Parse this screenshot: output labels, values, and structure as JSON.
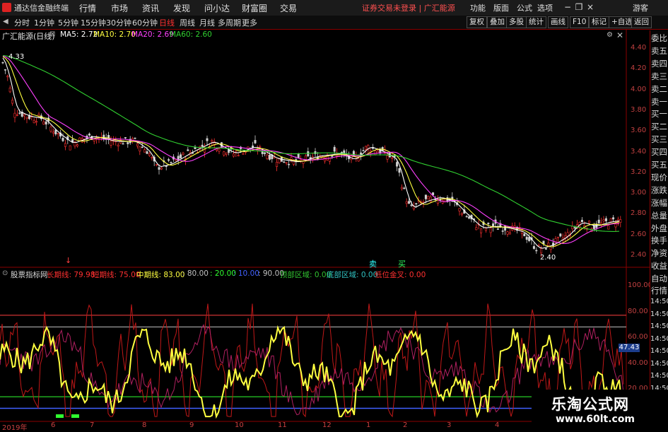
{
  "app": {
    "name": "通达信金融终端"
  },
  "menus": [
    "行情",
    "市场",
    "资讯",
    "发现",
    "问小达",
    "财富圈",
    "交易"
  ],
  "alert": "证券交易未登录",
  "alert_stock": "广汇能源",
  "right_menus": [
    "功能",
    "版面",
    "公式",
    "选项"
  ],
  "right_account": "游客",
  "period_tabs": [
    {
      "label": "分时"
    },
    {
      "label": "1分钟"
    },
    {
      "label": "5分钟"
    },
    {
      "label": "15分钟"
    },
    {
      "label": "30分钟"
    },
    {
      "label": "60分钟"
    },
    {
      "label": "日线",
      "active": true
    },
    {
      "label": "周线"
    },
    {
      "label": "月线"
    },
    {
      "label": "多周期"
    },
    {
      "label": "更多"
    }
  ],
  "right_tools": [
    "复权",
    "叠加",
    "多股",
    "统计",
    "画线",
    "F10",
    "标记",
    "+自选",
    "返回"
  ],
  "stock": {
    "name": "广汇能源(日线)",
    "ma5": "MA5: 2.72",
    "ma10": "MA10: 2.70",
    "ma20": "MA20: 2.69",
    "ma60": "MA60: 2.60",
    "high_label": "4.33",
    "low_label": "2.40"
  },
  "price_axis": [
    "4.40",
    "4.20",
    "4.00",
    "3.80",
    "3.60",
    "3.40",
    "3.20",
    "3.00",
    "2.80",
    "2.60",
    "2.40"
  ],
  "markers": {
    "down": "↓",
    "sell": "卖",
    "buy": "买"
  },
  "right_column": [
    "委比",
    "卖五",
    "卖四",
    "卖三",
    "卖二",
    "卖一",
    "买一",
    "买二",
    "买三",
    "买四",
    "买五",
    "现价",
    "涨跌",
    "涨幅",
    "总量",
    "外盘",
    "换手",
    "净资",
    "收益",
    "自动",
    "行情",
    "14:50",
    "14:50",
    "14:50",
    "14:50",
    "14:50",
    "14:50",
    "14:50",
    "14:50"
  ],
  "indicator": {
    "name": "股票指标网",
    "items": [
      {
        "label": "长期线: 79.98",
        "color": "#ff3030"
      },
      {
        "label": "短期线: 75.00",
        "color": "#ff3030"
      },
      {
        "label": "中期线: 83.00",
        "color": "#ffff40"
      },
      {
        "label": ": 80.00",
        "color": "#c0c0c0"
      },
      {
        "label": ": 20.00",
        "color": "#30ff30"
      },
      {
        "label": ": 10.00",
        "color": "#4060ff"
      },
      {
        "label": ": 90.00",
        "color": "#c0c0c0"
      },
      {
        "label": "顶部区域: 0.00",
        "color": "#30c030"
      },
      {
        "label": "底部区域: 0.00",
        "color": "#30c0c0"
      },
      {
        "label": "低位金叉: 0.00",
        "color": "#ff3030"
      }
    ],
    "axis": [
      "100.00",
      "80.00",
      "60.00",
      "40.00",
      "20.00"
    ],
    "current_value": "47.43"
  },
  "x_axis": [
    "2019年",
    "6",
    "7",
    "8",
    "9",
    "10",
    "11",
    "12",
    "1",
    "2",
    "3",
    "4"
  ],
  "watermark": {
    "line1": "乐淘公式网",
    "line2": "www.60lt.com"
  },
  "colors": {
    "ma5": "#ffffff",
    "ma10": "#ffff40",
    "ma20": "#ff40ff",
    "ma60": "#30d030",
    "up": "#ff3030",
    "down": "#30ffff"
  }
}
